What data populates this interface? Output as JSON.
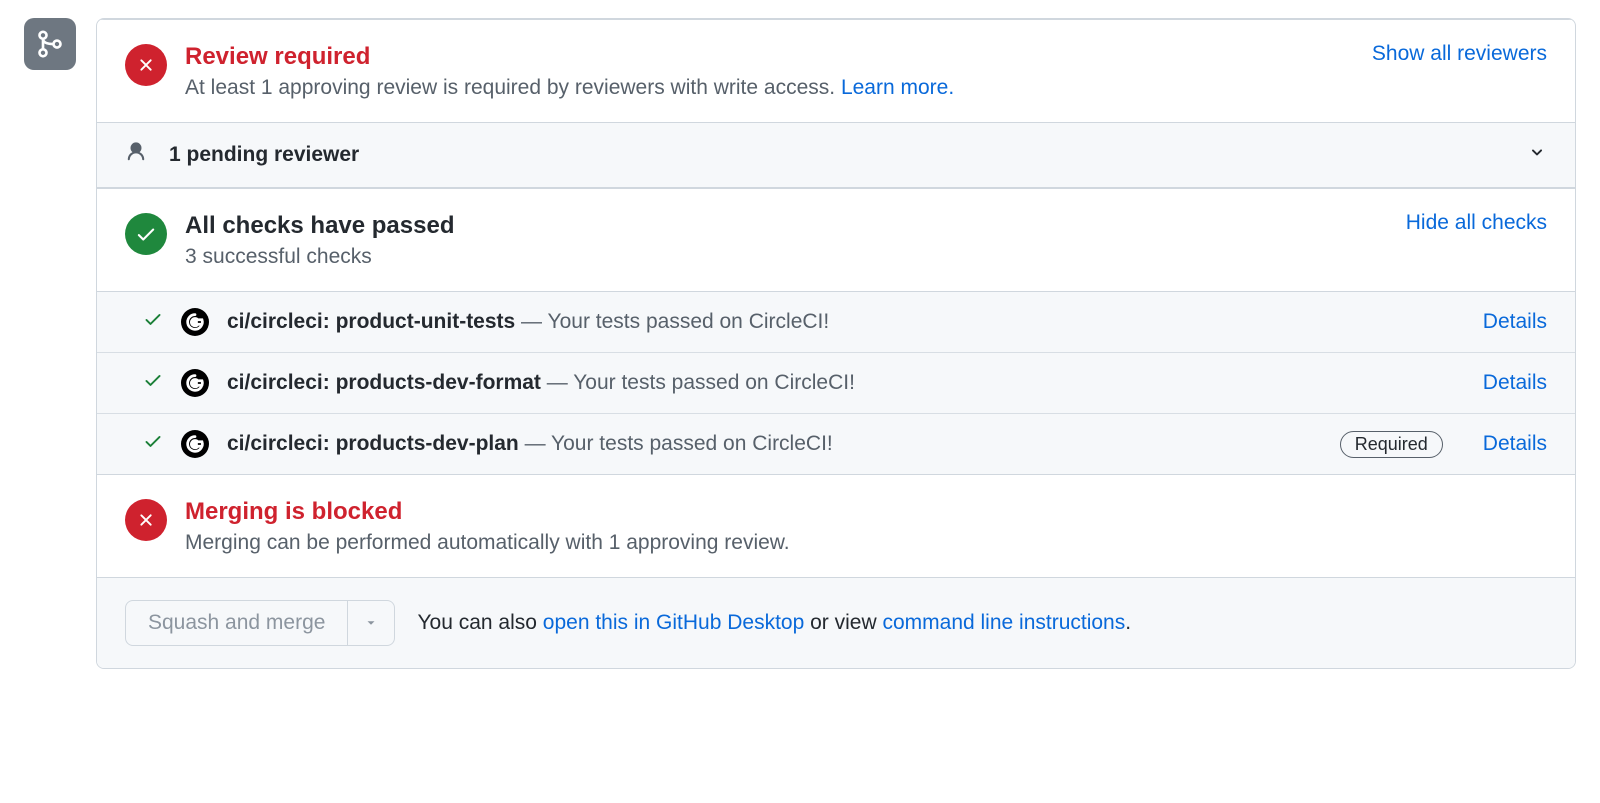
{
  "review": {
    "title": "Review required",
    "subtitle": "At least 1 approving review is required by reviewers with write access. ",
    "learn_more": "Learn more.",
    "show_all": "Show all reviewers"
  },
  "pending": {
    "label": "1 pending reviewer"
  },
  "checks_summary": {
    "title": "All checks have passed",
    "subtitle": "3 successful checks",
    "toggle": "Hide all checks"
  },
  "checks": [
    {
      "name": "ci/circleci: product-unit-tests",
      "msg": " — Your tests passed on CircleCI!",
      "required": false,
      "details": "Details"
    },
    {
      "name": "ci/circleci: products-dev-format",
      "msg": " — Your tests passed on CircleCI!",
      "required": false,
      "details": "Details"
    },
    {
      "name": "ci/circleci: products-dev-plan",
      "msg": " — Your tests passed on CircleCI!",
      "required": true,
      "details": "Details"
    }
  ],
  "required_label": "Required",
  "blocked": {
    "title": "Merging is blocked",
    "subtitle": "Merging can be performed automatically with 1 approving review."
  },
  "footer": {
    "button": "Squash and merge",
    "text_prefix": "You can also ",
    "link1": "open this in GitHub Desktop",
    "text_mid": " or view ",
    "link2": "command line instructions",
    "text_suffix": "."
  }
}
